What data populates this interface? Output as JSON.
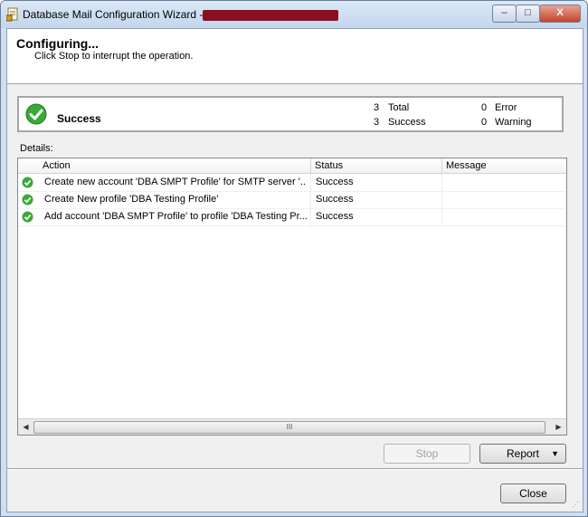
{
  "window": {
    "title": "Database Mail Configuration Wizard -",
    "minimize_label": "–",
    "maximize_label": "□",
    "close_label": "X"
  },
  "header": {
    "title": "Configuring...",
    "subtitle": "Click Stop to interrupt the operation."
  },
  "summary": {
    "status": "Success",
    "total_count": "3",
    "total_label": "Total",
    "success_count": "3",
    "success_label": "Success",
    "error_count": "0",
    "error_label": "Error",
    "warning_count": "0",
    "warning_label": "Warning"
  },
  "details": {
    "label": "Details:",
    "columns": [
      "Action",
      "Status",
      "Message"
    ],
    "rows": [
      {
        "action": "Create new account 'DBA SMPT Profile' for SMTP server '...",
        "status": "Success",
        "message": ""
      },
      {
        "action": "Create New profile 'DBA Testing Profile'",
        "status": "Success",
        "message": ""
      },
      {
        "action": "Add account 'DBA SMPT Profile' to profile 'DBA Testing Pr...",
        "status": "Success",
        "message": ""
      }
    ],
    "scroll_grip": "III"
  },
  "buttons": {
    "stop": "Stop",
    "report": "Report",
    "close": "Close"
  },
  "colors": {
    "success_green": "#3aa935",
    "redaction": "#8b0f1f"
  }
}
